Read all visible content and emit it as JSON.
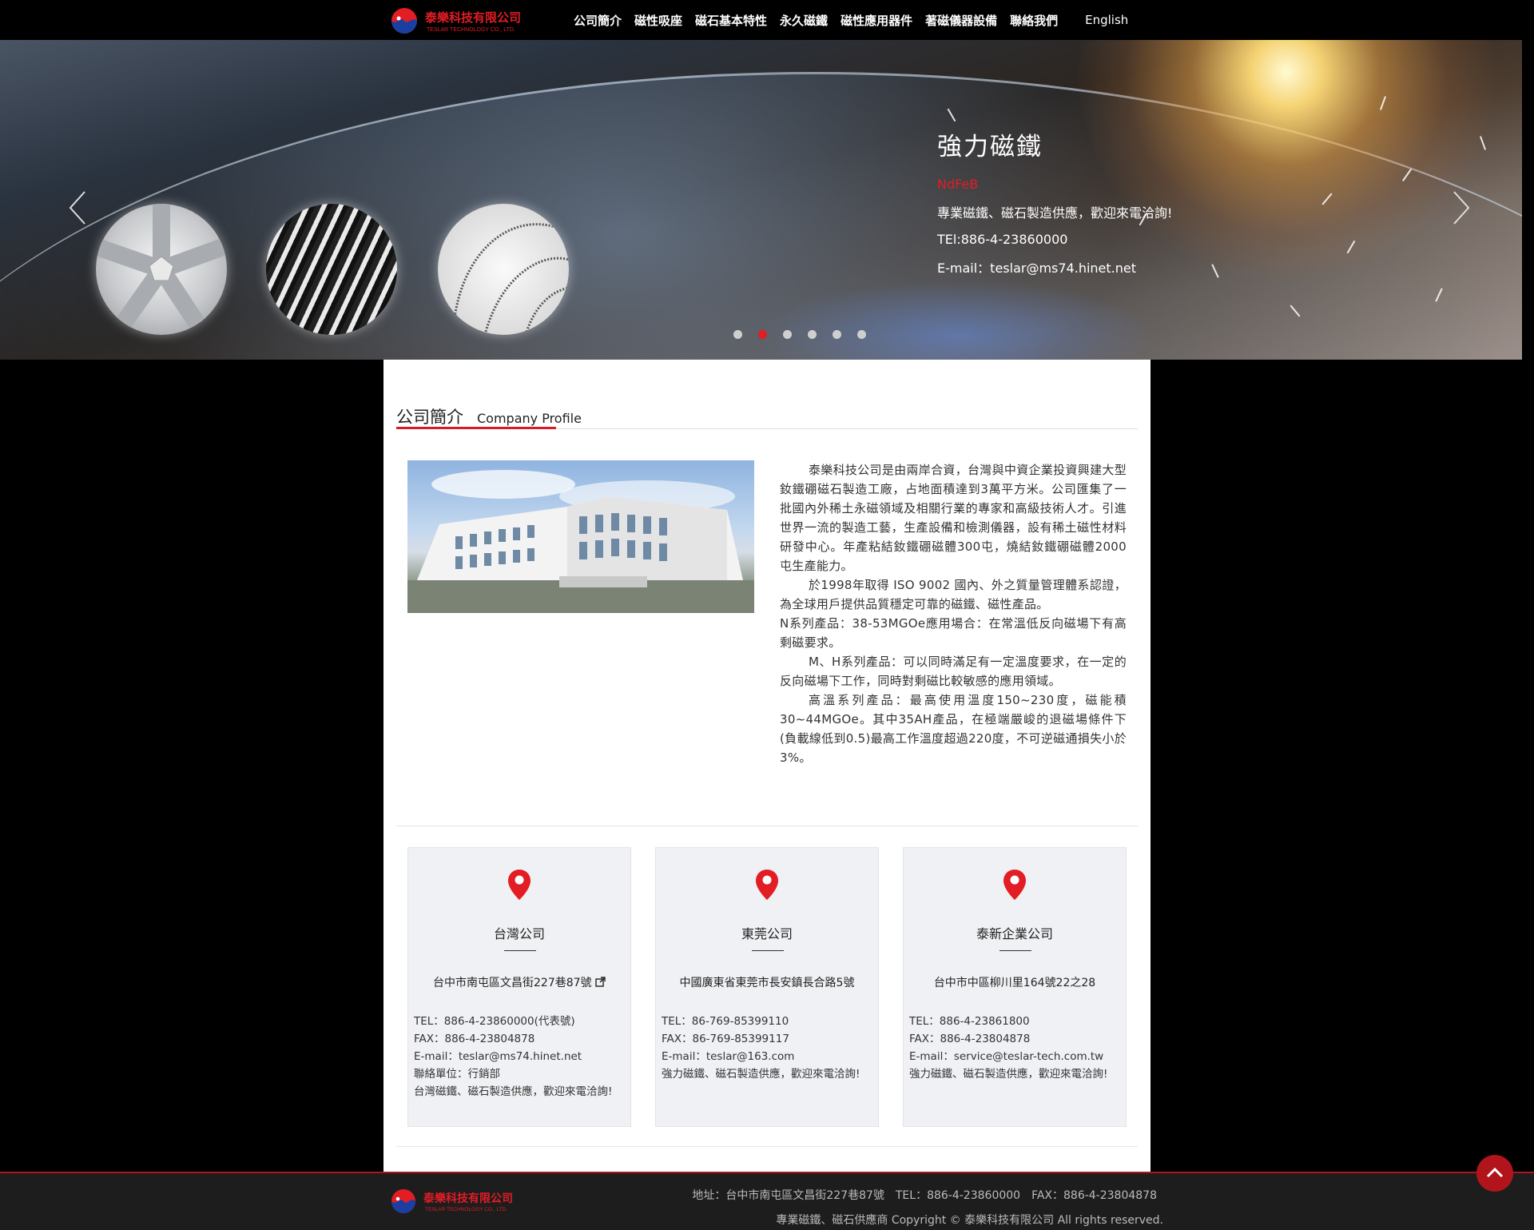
{
  "nav": {
    "logo_text_zh": "泰樂科技有限公司",
    "logo_text_en": "TESLAR TECHNOLOGY CO., LTD.",
    "items": [
      {
        "label": "公司簡介"
      },
      {
        "label": "磁性吸座"
      },
      {
        "label": "磁石基本特性"
      },
      {
        "label": "永久磁鐵"
      },
      {
        "label": "磁性應用器件"
      },
      {
        "label": "著磁儀器設備"
      },
      {
        "label": "聯絡我們"
      }
    ],
    "language": "English"
  },
  "banner": {
    "title": "強力磁鐵",
    "subtitle": "NdFeB",
    "tagline": "專業磁鐵、磁石製造供應，歡迎來電洽詢!",
    "tel": "TEl:886-4-23860000",
    "email": "E-mail：teslar@ms74.hinet.net",
    "dots": 6,
    "active_dot": 2,
    "prev_icon": "chevron-left-icon",
    "next_icon": "chevron-right-icon"
  },
  "profile": {
    "title_zh": "公司簡介",
    "title_en": "Company Profile",
    "paragraphs": [
      {
        "text": "泰樂科技公司是由兩岸合資，台灣與中資企業投資興建大型釹鐵硼磁石製造工廠，占地面積達到3萬平方米。公司匯集了一批國內外稀土永磁領域及相關行業的專家和高級技術人才。引進世界一流的製造工藝，生產設備和檢測儀器，設有稀土磁性材料研發中心。年產粘結釹鐵硼磁體300屯，燒結釹鐵硼磁體2000屯生產能力。",
        "indent": true
      },
      {
        "text": "於1998年取得 ISO 9002 國內、外之質量管理體系認證，為全球用戶提供品質穩定可靠的磁鐵、磁性產品。",
        "indent": true
      },
      {
        "text": "N系列產品：38-53MGOe應用場合：在常溫低反向磁場下有高剩磁要求。",
        "indent": false
      },
      {
        "text": "M、H系列產品：可以同時滿足有一定溫度要求，在一定的反向磁場下工作，同時對剩磁比較敏感的應用領域。",
        "indent": true
      },
      {
        "text": "高溫系列產品：最高使用溫度150~230度，磁能積30~44MGOe。其中35AH產品，在極端嚴峻的退磁場條件下(負載線低到0.5)最高工作溫度超過220度，不可逆磁通損失小於3%。",
        "indent": true
      }
    ]
  },
  "offices": [
    {
      "name": "台灣公司",
      "address": "台中市南屯區文昌街227巷87號",
      "tel": "TEL：886-4-23860000(代表號)",
      "fax": "FAX：886-4-23804878",
      "email": "E-mail：teslar@ms74.hinet.net",
      "contact": "聯絡單位：行銷部",
      "note": "台灣磁鐵、磁石製造供應，歡迎來電洽詢!"
    },
    {
      "name": "東莞公司",
      "address": "中國廣東省東莞市長安鎮長合路5號",
      "tel": "TEL：86-769-85399110",
      "fax": "FAX：86-769-85399117",
      "email": "E-mail：teslar@163.com",
      "note": "強力磁鐵、磁石製造供應，歡迎來電洽詢!"
    },
    {
      "name": "泰新企業公司",
      "address": "台中市中區柳川里164號22之28",
      "tel": "TEL：886-4-23861800",
      "fax": "FAX：886-4-23804878",
      "email": "E-mail：service@teslar-tech.com.tw",
      "note": "強力磁鐵、磁石製造供應，歡迎來電洽詢!"
    }
  ],
  "footer": {
    "address_line": "地址：台中市南屯區文昌街227巷87號　TEL：886-4-23860000　FAX：886-4-23804878",
    "copyright_line": "專業磁鐵、磁石供應商 Copyright © 泰樂科技有限公司 All rights reserved."
  },
  "colors": {
    "accent": "#d81c22",
    "nav_bg": "#000000",
    "card_bg": "#f0f1f4",
    "footer_bg": "#1d1d1d"
  }
}
